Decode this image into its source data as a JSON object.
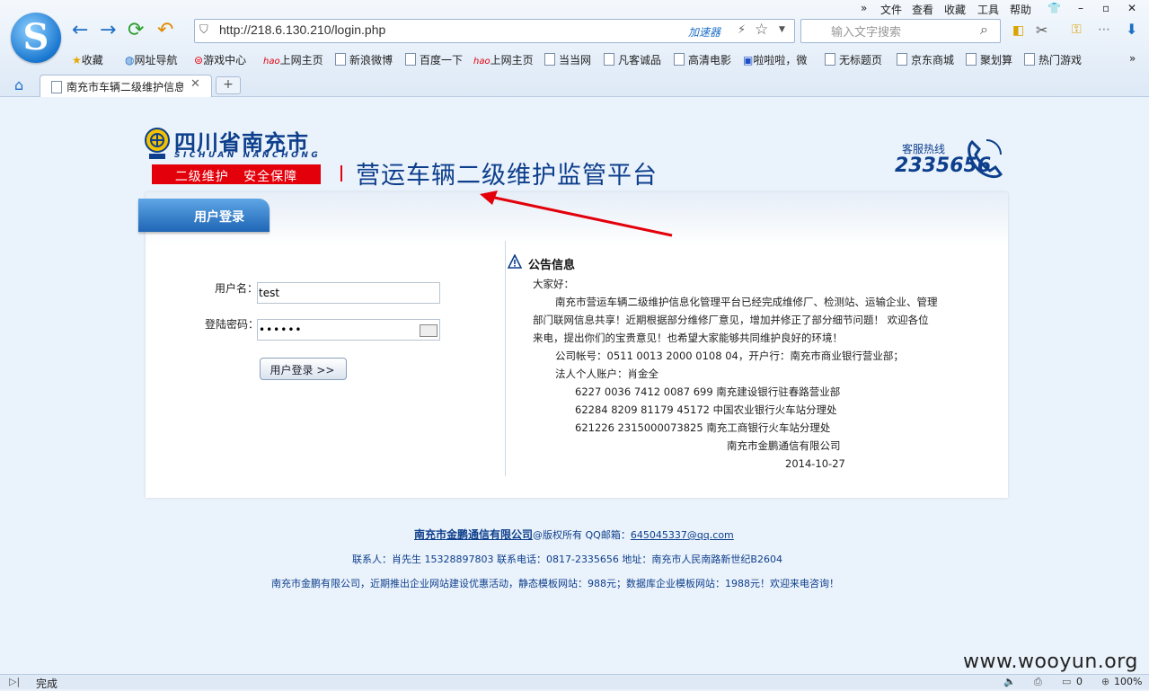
{
  "browser": {
    "menu": [
      "文件",
      "查看",
      "收藏",
      "工具",
      "帮助"
    ],
    "address": "http://218.6.130.210/login.php",
    "accelerator_label": "加速器",
    "search_placeholder": "输入文字搜索",
    "bookmarks": [
      "收藏",
      "网址导航",
      "游戏中心",
      "上网主页",
      "新浪微博",
      "百度一下",
      "上网主页",
      "当当网",
      "凡客诚品",
      "高清电影",
      "啦啦啦，微",
      "无标题页",
      "京东商城",
      "聚划算",
      "热门游戏"
    ],
    "tab_title": "南充市车辆二级维护信息",
    "tab_close": "✕",
    "new_tab": "+",
    "status_text": "完成",
    "zoom": "100%",
    "status_count": "0"
  },
  "header": {
    "province": "四川省南充市",
    "province_en": "SICHUAN NANCHONG",
    "slogan": "二级维护   安全保障",
    "platform_title": "营运车辆二级维护监管平台",
    "hotline_label": "客服热线",
    "hotline_number": "2335656"
  },
  "login": {
    "tab_label": "用户登录",
    "username_label": "用户名：",
    "username_value": "test",
    "password_label": "登陆密码：",
    "password_value": "••••••",
    "submit_label": "用户登录 >>"
  },
  "notice": {
    "title": "公告信息",
    "greeting": "大家好：",
    "lines": [
      "南充市营运车辆二级维护信息化管理平台已经完成维修厂、检测站、运输企业、管理",
      "部门联网信息共享！近期根据部分维修厂意见，增加并修正了部分细节问题！ 欢迎各位",
      "来电，提出你们的宝贵意见！也希望大家能够共同维护良好的环境！",
      "公司帐号：0511 0013 2000 0108 04，开户行：南充市商业银行营业部；",
      "法人个人账户：肖金全",
      "6227 0036 7412 0087 699 南充建设银行驻春路营业部",
      "62284 8209 81179 45172 中国农业银行火车站分理处",
      "621226 2315000073825 南充工商银行火车站分理处",
      "南充市金鹏通信有限公司",
      "2014-10-27"
    ]
  },
  "footer": {
    "company_link": "南充市金鹏通信有限公司",
    "copyright": "@版权所有  QQ邮箱：",
    "email": "645045337@qq.com",
    "contact": "联系人：肖先生 15328897803  联系电话：0817-2335656  地址：南充市人民南路新世纪B2604",
    "promo": "南充市金鹏有限公司，近期推出企业网站建设优惠活动，静态模板网站：988元；数据库企业模板网站：1988元！欢迎来电咨询！"
  },
  "watermark": "www.wooyun.org",
  "colors": {
    "brand_blue": "#0d3f8c",
    "slogan_red": "#e3000b",
    "arrow_red": "#e3000b"
  }
}
